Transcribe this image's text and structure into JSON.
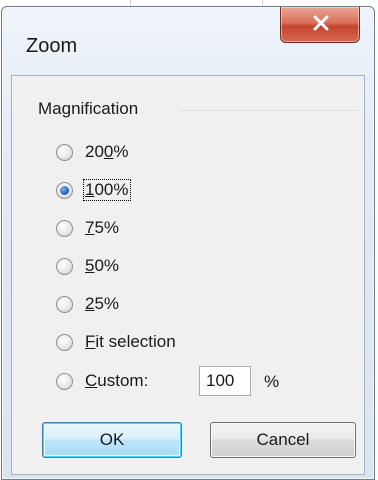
{
  "dialog": {
    "title": "Zoom",
    "close_icon": "close-x-icon"
  },
  "group": {
    "label": "Magnification"
  },
  "options": [
    {
      "label_before": "20",
      "mnemonic": "0",
      "label_after": "%",
      "checked": false
    },
    {
      "label_before": "",
      "mnemonic": "1",
      "label_after": "00%",
      "checked": true
    },
    {
      "label_before": "",
      "mnemonic": "7",
      "label_after": "5%",
      "checked": false
    },
    {
      "label_before": "",
      "mnemonic": "5",
      "label_after": "0%",
      "checked": false
    },
    {
      "label_before": "",
      "mnemonic": "2",
      "label_after": "5%",
      "checked": false
    },
    {
      "label_before": "",
      "mnemonic": "F",
      "label_after": "it selection",
      "checked": false
    },
    {
      "label_before": "",
      "mnemonic": "C",
      "label_after": "ustom:",
      "checked": false
    }
  ],
  "custom": {
    "value": "100",
    "unit": "%"
  },
  "buttons": {
    "ok": "OK",
    "cancel": "Cancel"
  },
  "colors": {
    "radio_selected": "#2a6bc2",
    "close_button": "#c4432c",
    "default_button_border": "#3c7fb1"
  }
}
